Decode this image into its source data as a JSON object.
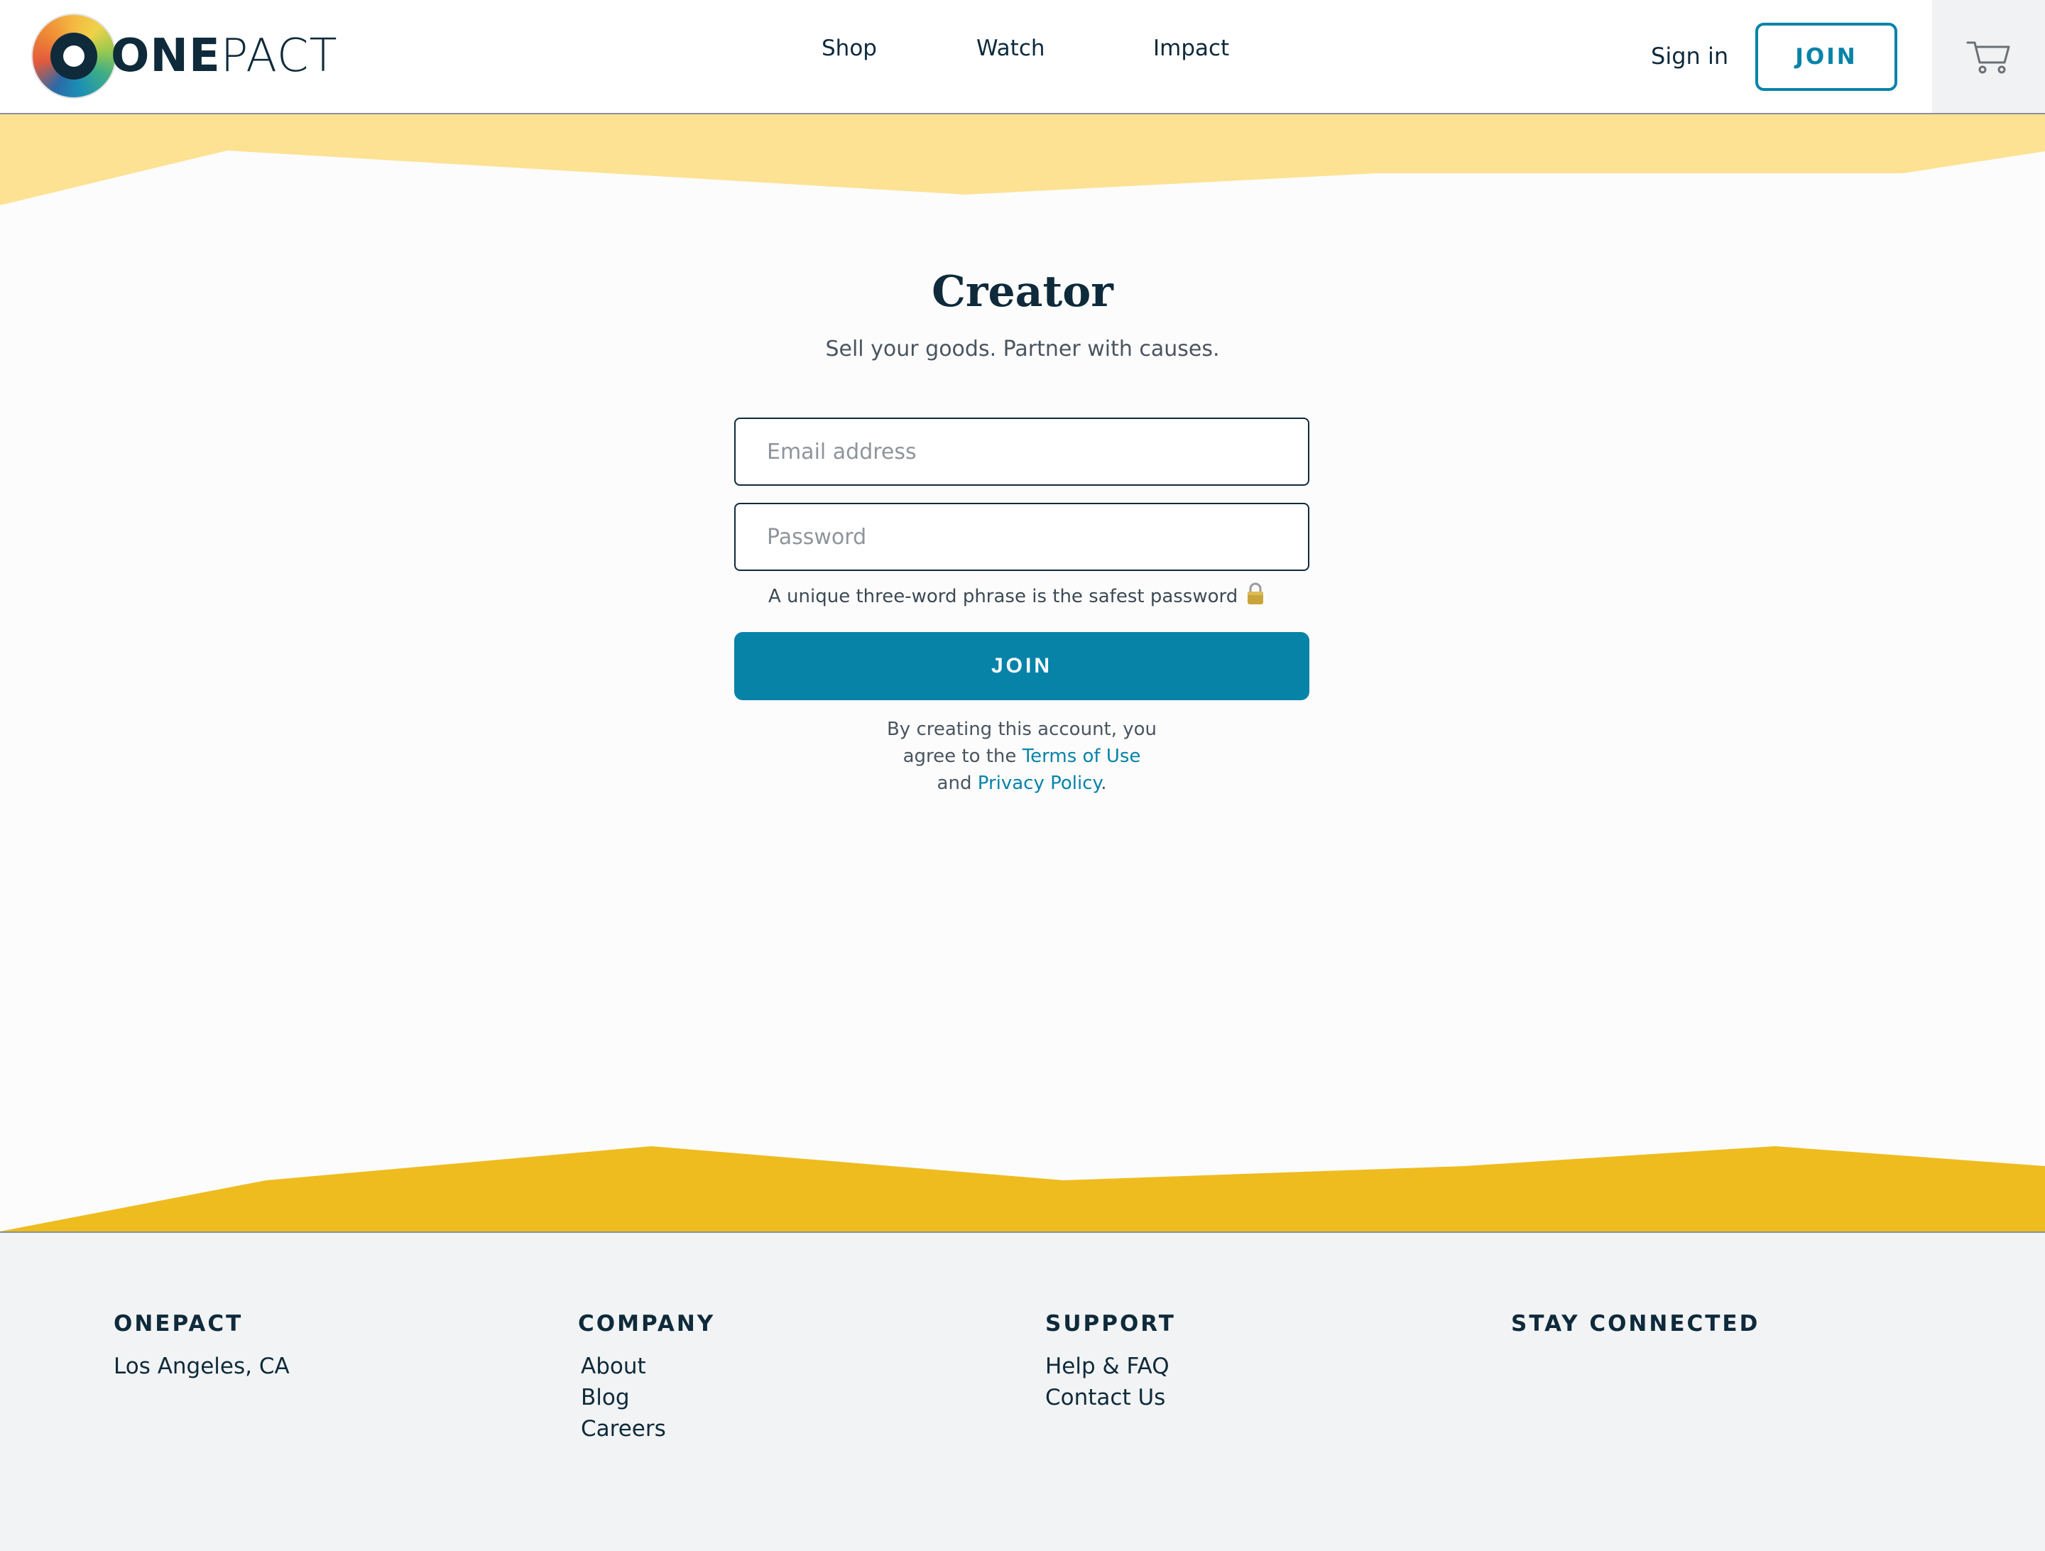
{
  "header": {
    "logo_bold": "ONE",
    "logo_light": "PACT",
    "nav": [
      "Shop",
      "Watch",
      "Impact"
    ],
    "sign_in": "Sign in",
    "join": "JOIN",
    "cart_icon": "cart-icon"
  },
  "main": {
    "title": "Creator",
    "subtitle": "Sell your goods. Partner with causes.",
    "email_placeholder": "Email address",
    "password_placeholder": "Password",
    "password_hint": "A unique three-word phrase is the safest password",
    "join_button": "JOIN",
    "legal_line1": "By creating this account, you",
    "legal_line2_prefix": "agree to the ",
    "terms_link": "Terms of Use",
    "legal_line3_prefix": "and ",
    "privacy_link": "Privacy Policy",
    "legal_suffix": "."
  },
  "footer": {
    "onepact": {
      "heading": "ONEPACT",
      "items": [
        "Los Angeles, CA"
      ]
    },
    "company": {
      "heading": "COMPANY",
      "items": [
        "About",
        "Blog",
        "Careers"
      ]
    },
    "support": {
      "heading": "SUPPORT",
      "items": [
        "Help & FAQ",
        "Contact Us"
      ]
    },
    "stay_connected": {
      "heading": "STAY CONNECTED"
    }
  },
  "colors": {
    "accent": "#0783a8",
    "wave_top": "#fde293",
    "wave_bottom": "#eebc1f",
    "text_dark": "#0e2a3b"
  }
}
